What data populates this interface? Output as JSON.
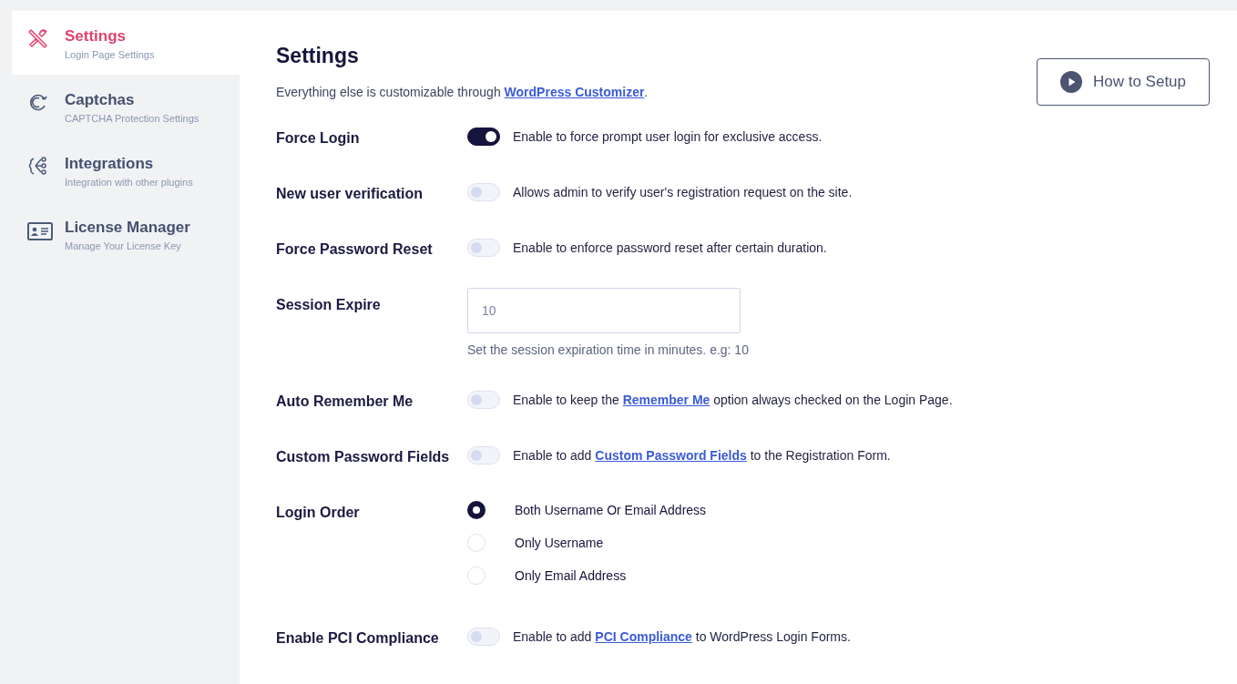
{
  "sidebar": {
    "items": [
      {
        "title": "Settings",
        "subtitle": "Login Page Settings",
        "selected": true
      },
      {
        "title": "Captchas",
        "subtitle": "CAPTCHA Protection Settings",
        "selected": false
      },
      {
        "title": "Integrations",
        "subtitle": "Integration with other plugins",
        "selected": false
      },
      {
        "title": "License Manager",
        "subtitle": "Manage Your License Key",
        "selected": false
      }
    ]
  },
  "header": {
    "title": "Settings",
    "intro": {
      "before": "Everything else is customizable through ",
      "link": "WordPress Customizer",
      "after": "."
    },
    "setup_button": "How to Setup"
  },
  "settings": [
    {
      "kind": "toggle",
      "label": "Force Login",
      "on": true,
      "description": {
        "before": "Enable to force prompt user login for exclusive access."
      }
    },
    {
      "kind": "toggle",
      "label": "New user verification",
      "on": false,
      "description": {
        "before": "Allows admin to verify user's registration request on the site."
      }
    },
    {
      "kind": "toggle",
      "label": "Force Password Reset",
      "on": false,
      "description": {
        "before": "Enable to enforce password reset after certain duration."
      }
    },
    {
      "kind": "input",
      "label": "Session Expire",
      "placeholder": "10",
      "hint": "Set the session expiration time in minutes. e.g: 10"
    },
    {
      "kind": "toggle",
      "label": "Auto Remember Me",
      "on": false,
      "description": {
        "before": "Enable to keep the ",
        "link": "Remember Me",
        "after": " option always checked on the Login Page."
      }
    },
    {
      "kind": "toggle",
      "label": "Custom Password Fields",
      "on": false,
      "description": {
        "before": "Enable to add ",
        "link": "Custom Password Fields",
        "after": " to the Registration Form."
      }
    },
    {
      "kind": "radio",
      "label": "Login Order",
      "options": [
        {
          "label": "Both Username Or Email Address",
          "selected": true
        },
        {
          "label": "Only Username",
          "selected": false
        },
        {
          "label": "Only Email Address",
          "selected": false
        }
      ]
    },
    {
      "kind": "toggle",
      "label": "Enable PCI Compliance",
      "on": false,
      "description": {
        "before": "Enable to add ",
        "link": "PCI Compliance",
        "after": " to WordPress Login Forms."
      }
    }
  ]
}
